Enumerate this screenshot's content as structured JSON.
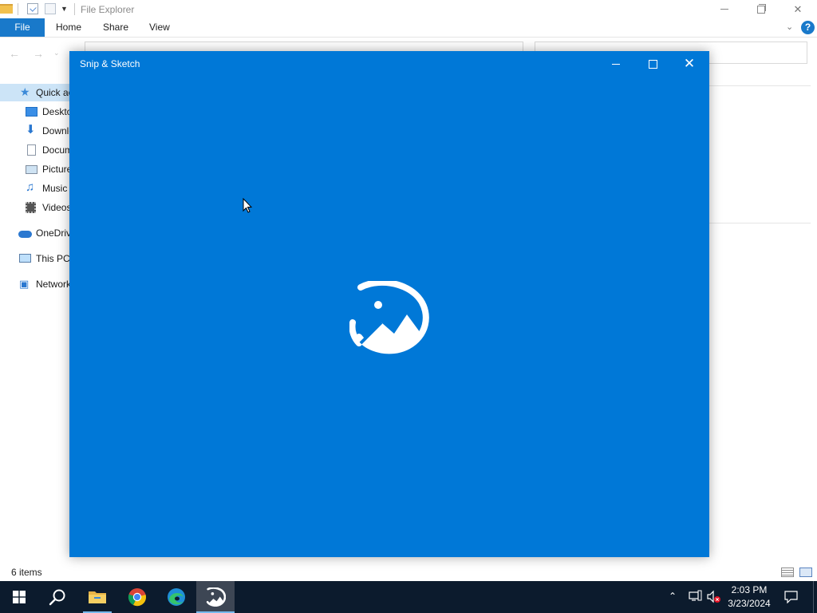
{
  "file_explorer": {
    "title": "File Explorer",
    "ribbon_tabs": [
      "File",
      "Home",
      "Share",
      "View"
    ],
    "sidebar_items": [
      {
        "label": "Quick access",
        "icon": "star-icon"
      },
      {
        "label": "Desktop",
        "icon": "desktop-icon"
      },
      {
        "label": "Downloads",
        "icon": "download-arrow-icon"
      },
      {
        "label": "Documents",
        "icon": "document-icon"
      },
      {
        "label": "Pictures",
        "icon": "picture-icon"
      },
      {
        "label": "Music",
        "icon": "music-note-icon"
      },
      {
        "label": "Videos",
        "icon": "film-icon"
      },
      {
        "label": "OneDrive",
        "icon": "cloud-icon"
      },
      {
        "label": "This PC",
        "icon": "monitor-icon"
      },
      {
        "label": "Network",
        "icon": "network-icon"
      }
    ],
    "status": {
      "item_count": "6 items"
    }
  },
  "snip_window": {
    "title": "Snip & Sketch",
    "background_color": "#0078d7"
  },
  "taskbar": {
    "apps": [
      {
        "name": "Start",
        "icon": "windows-logo-icon"
      },
      {
        "name": "Search",
        "icon": "search-icon"
      },
      {
        "name": "File Explorer",
        "icon": "folder-icon"
      },
      {
        "name": "Google Chrome",
        "icon": "chrome-icon"
      },
      {
        "name": "Microsoft Edge",
        "icon": "edge-icon"
      },
      {
        "name": "Snip & Sketch",
        "icon": "snip-sketch-icon",
        "active": true
      }
    ],
    "clock": {
      "time": "2:03 PM",
      "date": "3/23/2024"
    },
    "background_color": "#0c1b2d"
  }
}
